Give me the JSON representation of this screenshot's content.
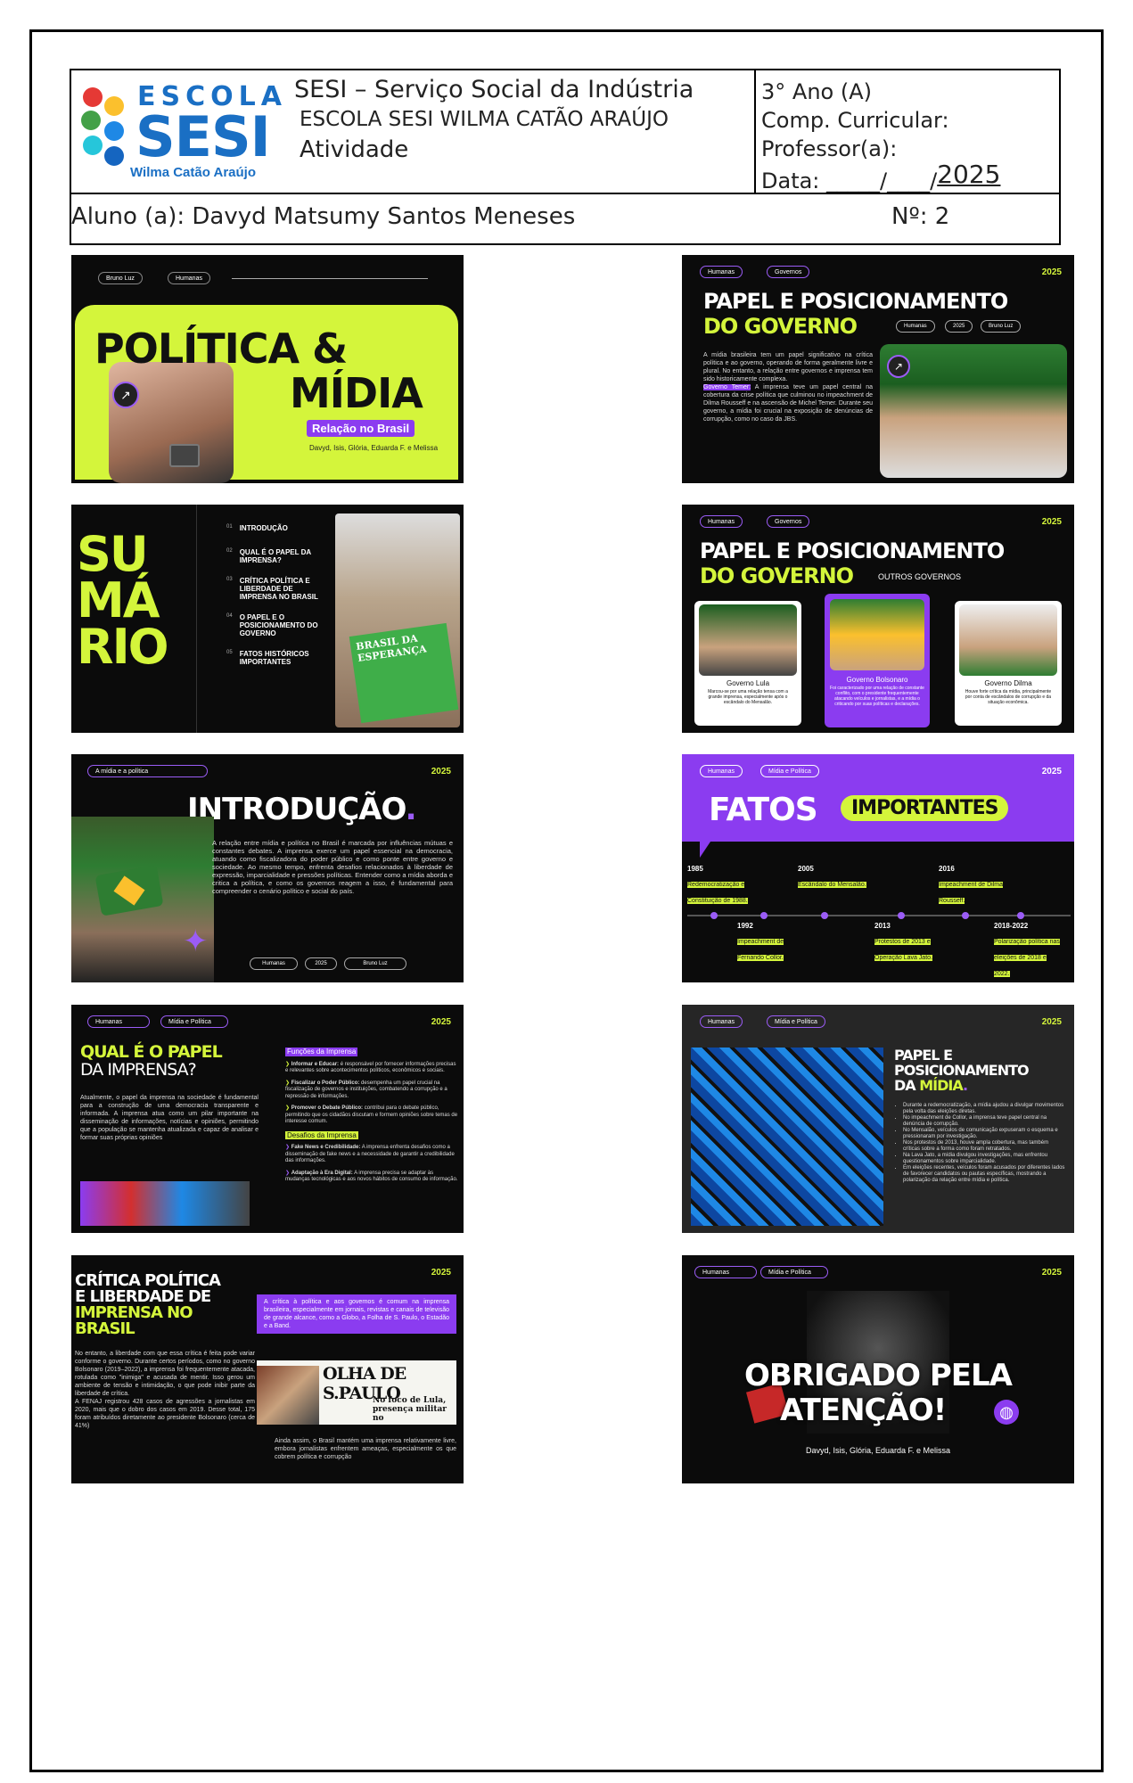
{
  "header": {
    "school_logo_top": "ESCOLA",
    "school_logo_main": "SESI",
    "school_logo_sub": "Wilma Catão Araújo",
    "line1": "SESI – Serviço Social da Indústria",
    "line2": "ESCOLA SESI WILMA CATÃO ARAÚJO",
    "line3": "Atividade",
    "grade": "3° Ano (A)",
    "component": "Comp. Curricular:",
    "teacher": "Professor(a):",
    "date_label": "Data: _____/____/",
    "date_year": "2025",
    "student": "Aluno (a): Davyd Matsumy Santos Meneses",
    "number": "Nº: 2"
  },
  "slides": {
    "s1": {
      "pill1": "Bruno Luz",
      "pill2": "Humanas",
      "title1": "POLÍTICA &",
      "title2": "MÍDIA",
      "subtitle": "Relação no Brasil",
      "authors": "Davyd, Isis, Glória, Eduarda F. e Melissa"
    },
    "s2": {
      "pill1": "Humanas",
      "pill2": "Governos",
      "year": "2025",
      "title1": "PAPEL E POSICIONAMENTO",
      "title2": "DO GOVERNO",
      "tag1": "Humanas",
      "tag2": "2025",
      "tag3": "Bruno Luz",
      "p1": "A mídia brasileira tem um papel significativo na crítica política e ao governo, operando de forma geralmente livre e plural. No entanto, a relação entre governos e imprensa tem sido historicamente complexa.",
      "p2_hl": "Governo Temer:",
      "p2": " A imprensa teve um papel central na cobertura da crise política que culminou no impeachment de Dilma Rousseff e na ascensão de Michel Temer. Durante seu governo, a mídia foi crucial na exposição de denúncias de corrupção, como no caso da JBS."
    },
    "s3": {
      "title1": "SU",
      "title2": "MÁ",
      "title3": "RIO",
      "items": [
        {
          "n": "01",
          "t": "INTRODUÇÃO"
        },
        {
          "n": "02",
          "t": "QUAL É O PAPEL DA IMPRENSA?"
        },
        {
          "n": "03",
          "t": "CRÍTICA POLÍTICA E LIBERDADE DE IMPRENSA NO BRASIL"
        },
        {
          "n": "04",
          "t": "O PAPEL E O POSICIONAMENTO DO GOVERNO"
        },
        {
          "n": "05",
          "t": "FATOS HISTÓRICOS IMPORTANTES"
        }
      ],
      "book": "BRASIL DA ESPERANÇA"
    },
    "s4": {
      "pill1": "Humanas",
      "pill2": "Governos",
      "year": "2025",
      "title1": "PAPEL E POSICIONAMENTO",
      "title2": "DO GOVERNO",
      "title3": "OUTROS GOVERNOS",
      "cards": [
        {
          "name": "Governo Lula",
          "desc": "Marcou-se por uma relação tensa com a grande imprensa, especialmente após o escândalo do Mensalão."
        },
        {
          "name": "Governo Bolsonaro",
          "desc": "Foi caracterizado por uma relação de constante conflito, com o presidente frequentemente atacando veículos e jornalistas, e a mídia o criticando por suas políticas e declarações."
        },
        {
          "name": "Governo Dilma",
          "desc": "Houve forte crítica da mídia, principalmente por conta de escândalos de corrupção e da situação econômica."
        }
      ]
    },
    "s5": {
      "pill1": "A mídia e a política",
      "year": "2025",
      "title": "INTRODUÇÃO",
      "body": "A relação entre mídia e política no Brasil é marcada por influências mútuas e constantes debates. A imprensa exerce um papel essencial na democracia, atuando como fiscalizadora do poder público e como ponte entre governo e sociedade. Ao mesmo tempo, enfrenta desafios relacionados à liberdade de expressão, imparcialidade e pressões políticas. Entender como a mídia aborda e critica a política, e como os governos reagem a isso, é fundamental para compreender o cenário político e social do país.",
      "tag1": "Humanas",
      "tag2": "2025",
      "tag3": "Bruno Luz"
    },
    "s6": {
      "pill1": "Humanas",
      "pill2": "Mídia e Política",
      "year": "2025",
      "title1": "FATOS",
      "title2": "IMPORTANTES",
      "events": [
        {
          "y": "1985",
          "t": "Redemocratização e Constituição de 1988."
        },
        {
          "y": "1992",
          "t": "Impeachment de Fernando Collor."
        },
        {
          "y": "2005",
          "t": "Escândalo do Mensalão."
        },
        {
          "y": "2013",
          "t": "Protestos de 2013 e Operação Lava Jato."
        },
        {
          "y": "2016",
          "t": "Impeachment de Dilma Rousseff."
        },
        {
          "y": "2018-2022",
          "t": "Polarização política nas eleições de 2018 e 2022."
        }
      ]
    },
    "s7": {
      "pill1": "Humanas",
      "pill2": "Mídia e Política",
      "year": "2025",
      "title1": "QUAL É O PAPEL",
      "title2": "DA IMPRENSA?",
      "left": "Atualmente, o papel da imprensa na sociedade é fundamental para a construção de uma democracia transparente e informada. A imprensa atua como um pilar importante na disseminação de informações, notícias e opiniões, permitindo que a população se mantenha atualizada e capaz de analisar e formar suas próprias opiniões",
      "h1": "Funções da Imprensa",
      "f1b": "Informar e Educar:",
      "f1": " é responsável por fornecer informações precisas e relevantes sobre acontecimentos políticos, econômicos e sociais.",
      "f2b": "Fiscalizar o Poder Público:",
      "f2": " desempenha um papel crucial na fiscalização de governos e instituições, combatendo a corrupção e a repressão de informações.",
      "f3b": "Promover o Debate Público:",
      "f3": " contribui para o debate público, permitindo que os cidadãos discutam e formem opiniões sobre temas de interesse comum.",
      "h2": "Desafios da Imprensa",
      "d1b": "Fake News e Credibilidade:",
      "d1": " A imprensa enfrenta desafios como a disseminação de fake news e a necessidade de garantir a credibilidade das informações.",
      "d2b": "Adaptação à Era Digital:",
      "d2": " A imprensa precisa se adaptar às mudanças tecnológicas e aos novos hábitos de consumo de informação."
    },
    "s8": {
      "pill1": "Humanas",
      "pill2": "Mídia e Política",
      "year": "2025",
      "title1": "PAPEL E",
      "title2": "POSICIONAMENTO",
      "title3": "DA",
      "title4": "MÍDIA",
      "bullets": [
        "Durante a redemocratização, a mídia ajudou a divulgar movimentos pela volta das eleições diretas.",
        "No impeachment de Collor, a imprensa teve papel central na denúncia de corrupção.",
        "No Mensalão, veículos de comunicação expuseram o esquema e pressionaram por investigação.",
        "Nos protestos de 2013, houve ampla cobertura, mas também críticas sobre a forma como foram retratados.",
        "Na Lava Jato, a mídia divulgou investigações, mas enfrentou questionamentos sobre imparcialidade.",
        "Em eleições recentes, veículos foram acusados por diferentes lados de favorecer candidatos ou pautas específicas, mostrando a polarização da relação entre mídia e política."
      ]
    },
    "s9": {
      "year": "2025",
      "title1": "CRÍTICA POLÍTICA",
      "title2": "E LIBERDADE DE",
      "title3": "IMPRENSA NO",
      "title4": "BRASIL",
      "box": "A crítica à política e aos governos é comum na imprensa brasileira, especialmente em jornais, revistas e canais de televisão de grande alcance, como a Globo, a Folha de S. Paulo, o Estadão e a Band.",
      "left": "No entanto, a liberdade com que essa crítica é feita pode variar conforme o governo. Durante certos períodos, como no governo Bolsonaro (2019–2022), a imprensa foi frequentemente atacada, rotulada como \"inimiga\" e acusada de mentir. Isso gerou um ambiente de tensão e intimidação, o que pode inibir parte da liberdade de crítica.\nA FENAJ registrou 428 casos de agressões a jornalistas em 2020, mais que o dobro dos casos em 2019. Desse total, 175 foram atribuídos diretamente ao presidente Bolsonaro (cerca de 41%)",
      "paper": "OLHA DE S.PAULO",
      "headline": "No foco de Lula, presença militar no",
      "bottom": "Ainda assim, o Brasil mantém uma imprensa relativamente livre, embora jornalistas enfrentem ameaças, especialmente os que cobrem política e corrupção"
    },
    "s10": {
      "pill1": "Humanas",
      "pill2": "Mídia e Política",
      "year": "2025",
      "title1": "OBRIGADO PELA",
      "title2": "ATENÇÃO!",
      "authors": "Davyd, Isis, Glória, Eduarda F. e Melissa"
    }
  }
}
